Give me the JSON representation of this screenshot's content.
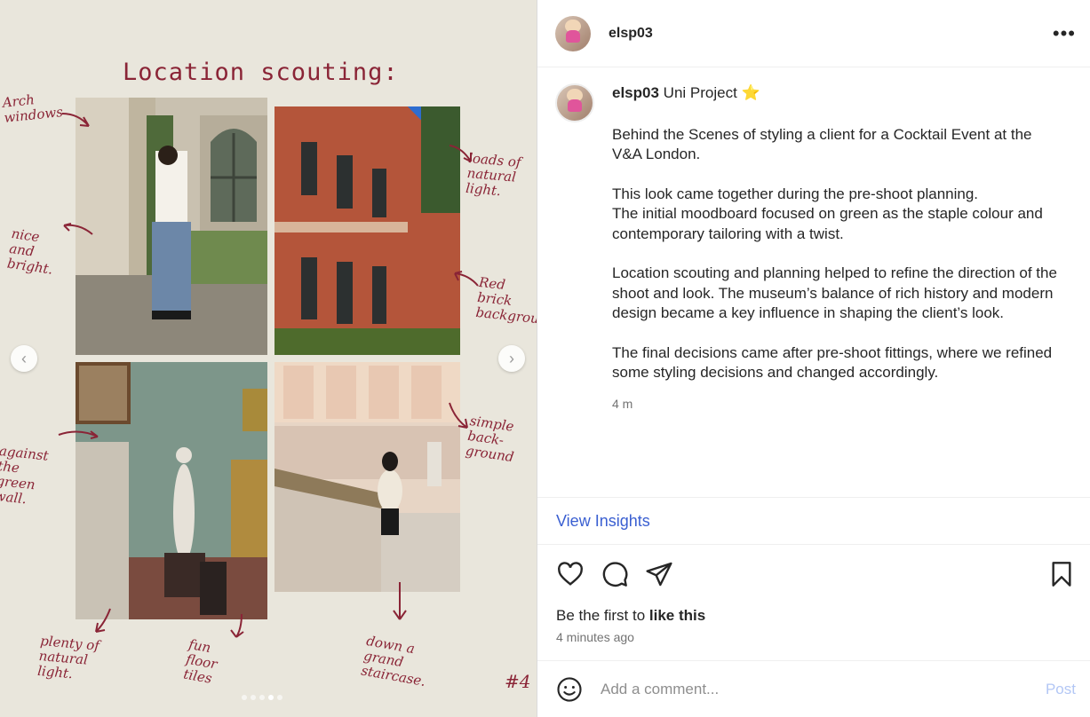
{
  "media": {
    "title": "Location scouting:",
    "notes": {
      "arch": "Arch\nwindows",
      "nice": "nice\nand\nbright.",
      "loads": "loads of\nnatural\nlight.",
      "red": "Red\nbrick\nbackgrou",
      "against": "against\nthe\ngreen\nwall.",
      "simple": "simple\nback-\nground",
      "plenty": "plenty of\nnatural\nlight.",
      "fun": "fun\nfloor\ntiles",
      "down": "down a\ngrand\nstaircase.",
      "page": "#4"
    },
    "prev_icon": "chevron-left-icon",
    "next_icon": "chevron-right-icon",
    "prev_glyph": "‹",
    "next_glyph": "›",
    "slide_count": 5,
    "active_slide": 4
  },
  "header": {
    "username": "elsp03",
    "more_glyph": "•••"
  },
  "caption": {
    "username": "elsp03",
    "title": "Uni Project",
    "star": "⭐",
    "paragraphs": [
      "Behind the Scenes of styling a client for a Cocktail Event at the V&A London.",
      "This look came together during the pre-shoot planning.\nThe initial moodboard focused on green as the staple colour and contemporary tailoring with a twist.",
      "Location scouting and planning helped to refine the direction of the shoot and look. The museum’s balance of rich history and modern design became a key influence in shaping the client’s look.",
      "The final decisions came after pre-shoot fittings, where we refined some styling decisions and changed accordingly."
    ],
    "time": "4 m"
  },
  "insights": {
    "label": "View Insights"
  },
  "likes": {
    "prefix": "Be the first to ",
    "bold": "like this"
  },
  "posted": "4 minutes ago",
  "comment": {
    "placeholder": "Add a comment...",
    "post_label": "Post"
  },
  "colors": {
    "accent": "#3a5fd1",
    "note_ink": "#8a2436",
    "media_bg": "#e9e6dc",
    "post_disabled": "#b3c7f5"
  }
}
